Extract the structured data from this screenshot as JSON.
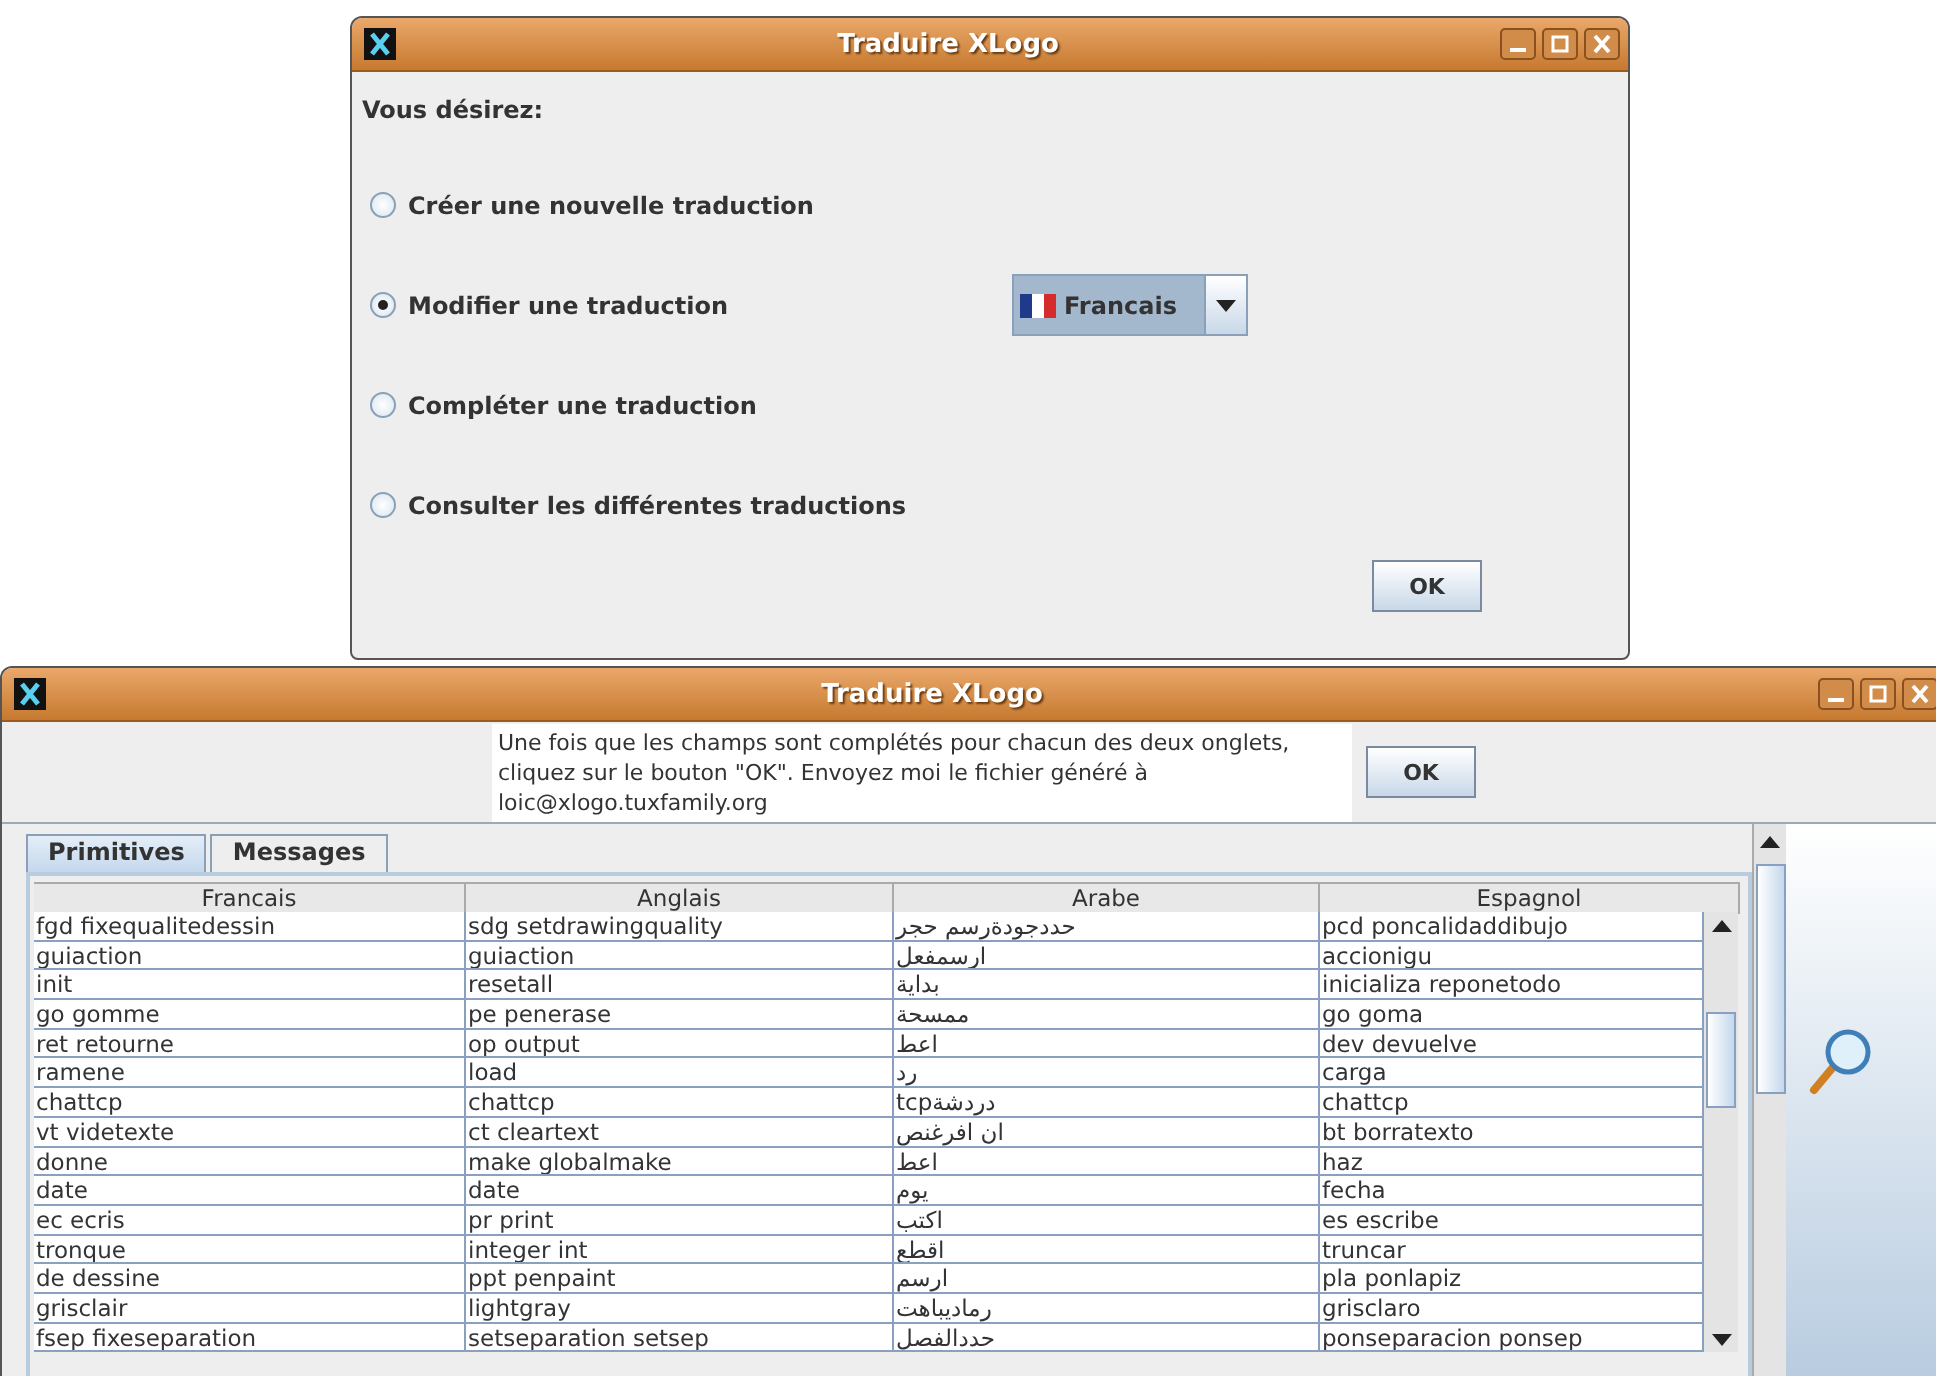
{
  "dialog": {
    "title": "Traduire XLogo",
    "prompt": "Vous désirez:",
    "options": [
      {
        "label": "Créer une nouvelle traduction",
        "selected": false
      },
      {
        "label": "Modifier une traduction",
        "selected": true
      },
      {
        "label": "Compléter une traduction",
        "selected": false
      },
      {
        "label": "Consulter les différentes traductions",
        "selected": false
      }
    ],
    "language_combo": {
      "value": "Francais"
    },
    "ok_button": "OK"
  },
  "editor": {
    "title": "Traduire XLogo",
    "message": "Une fois que les champs sont complétés pour chacun des deux onglets, cliquez sur le bouton \"OK\". Envoyez moi le fichier généré à loic@xlogo.tuxfamily.org",
    "ok_button": "OK",
    "tabs": [
      {
        "label": "Primitives",
        "selected": true
      },
      {
        "label": "Messages",
        "selected": false
      }
    ],
    "table": {
      "columns": [
        "Francais",
        "Anglais",
        "Arabe",
        "Espagnol"
      ],
      "rows": [
        [
          "fgd fixequalitedessin",
          "sdg setdrawingquality",
          "حددجودةرسم حجر",
          "pcd poncalidaddibujo"
        ],
        [
          "guiaction",
          "guiaction",
          "ارسمفعل",
          "accionigu"
        ],
        [
          "init",
          "resetall",
          "بداية",
          "inicializa reponetodo"
        ],
        [
          "go gomme",
          "pe penerase",
          "ممسحة",
          "go goma"
        ],
        [
          "ret retourne",
          "op output",
          "اعط",
          "dev devuelve"
        ],
        [
          "ramene",
          "load",
          "رد",
          "carga"
        ],
        [
          "chattcp",
          "chattcp",
          "دردشةtcp",
          "chattcp"
        ],
        [
          "vt videtexte",
          "ct cleartext",
          "ان افرغنص",
          "bt borratexto"
        ],
        [
          "donne",
          "make globalmake",
          "اعط",
          "haz"
        ],
        [
          "date",
          "date",
          "يوم",
          "fecha"
        ],
        [
          "ec ecris",
          "pr print",
          "اكتب",
          "es escribe"
        ],
        [
          "tronque",
          "integer int",
          "اقطع",
          "truncar"
        ],
        [
          "de dessine",
          "ppt penpaint",
          "ارسم",
          "pla ponlapiz"
        ],
        [
          "grisclair",
          "lightgray",
          "رماديباهت",
          "grisclaro"
        ],
        [
          "fsep fixeseparation",
          "setseparation setsep",
          "حددالفصل",
          "ponseparacion ponsep"
        ]
      ]
    }
  }
}
